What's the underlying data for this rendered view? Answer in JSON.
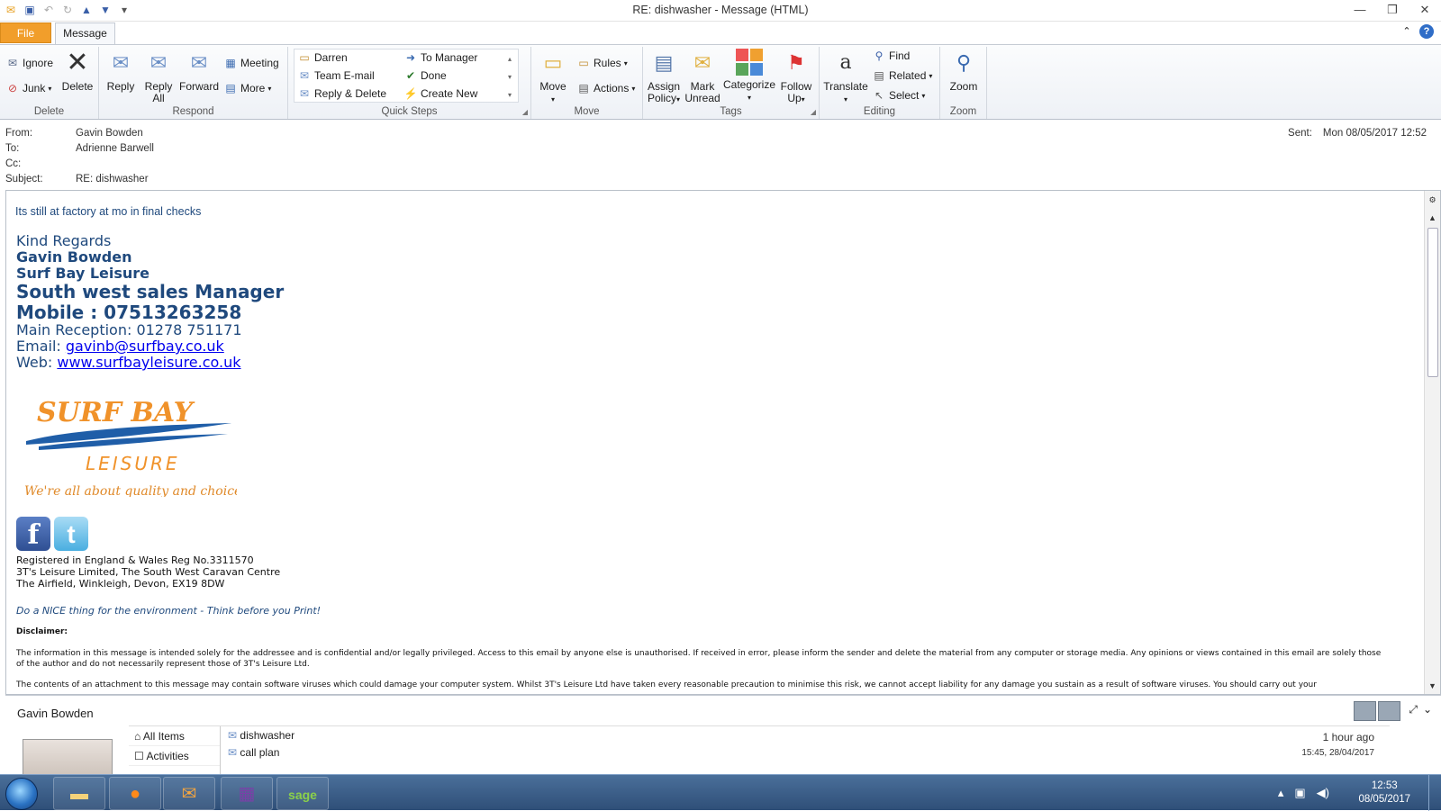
{
  "window": {
    "title": "RE: dishwasher  -  Message (HTML)",
    "min": "—",
    "max": "❐",
    "close": "✕"
  },
  "tabs": {
    "file": "File",
    "message": "Message"
  },
  "ribbon": {
    "delete_group": {
      "ignore": "Ignore",
      "junk": "Junk",
      "delete": "Delete",
      "label": "Delete"
    },
    "respond_group": {
      "reply": "Reply",
      "reply_all_1": "Reply",
      "reply_all_2": "All",
      "forward": "Forward",
      "meeting": "Meeting",
      "more": "More",
      "label": "Respond"
    },
    "quick_steps": {
      "items": [
        "Darren",
        "Team E-mail",
        "Reply & Delete",
        "To Manager",
        "Done",
        "Create New"
      ],
      "label": "Quick Steps"
    },
    "move_group": {
      "move": "Move",
      "rules": "Rules",
      "actions": "Actions",
      "label": "Move"
    },
    "tags_group": {
      "assign_1": "Assign",
      "assign_2": "Policy",
      "mark_1": "Mark",
      "mark_2": "Unread",
      "categorize": "Categorize",
      "follow_1": "Follow",
      "follow_2": "Up",
      "label": "Tags"
    },
    "editing_group": {
      "translate": "Translate",
      "find": "Find",
      "related": "Related",
      "select": "Select",
      "label": "Editing"
    },
    "zoom_group": {
      "zoom": "Zoom",
      "label": "Zoom"
    }
  },
  "header": {
    "from_label": "From:",
    "from": "Gavin Bowden",
    "to_label": "To:",
    "to": "Adrienne Barwell",
    "cc_label": "Cc:",
    "cc": "",
    "subject_label": "Subject:",
    "subject": "RE: dishwasher",
    "sent_label": "Sent:",
    "sent": "Mon 08/05/2017 12:52"
  },
  "body": {
    "opening": "Its still at factory at mo in final checks",
    "regards": "Kind Regards",
    "name": "Gavin Bowden",
    "company": "Surf Bay Leisure",
    "role": "South west sales Manager",
    "mobile": "Mobile : 07513263258",
    "reception": "Main Reception:  01278 751171",
    "email_label": "Email: ",
    "email": "gavinb@surfbay.co.uk",
    "web_label": "Web: ",
    "web": "www.surfbayleisure.co.uk",
    "logo": {
      "line1": "SURF BAY",
      "line2": "LEISURE",
      "tagline": "We're all about quality and choice!"
    },
    "reg_1": "Registered in England & Wales Reg No.3311570",
    "reg_2": "3T's Leisure Limited, The South West Caravan Centre",
    "reg_3": "The Airfield, Winkleigh, Devon, EX19 8DW",
    "nice": "Do a NICE thing for the environment - Think before you Print!",
    "disclaimer_title": "Disclaimer:",
    "disclaimer_1": "The information in this message is intended solely for the addressee and is confidential and/or legally privileged. Access to this email by anyone else is unauthorised. If received in error, please inform the sender and delete the material from any computer or storage media. Any opinions or views contained in this email are solely those of the author and do not necessarily represent those of 3T's Leisure Ltd.",
    "disclaimer_2": "The contents of an attachment to this message may contain software viruses which could damage your computer system. Whilst 3T's Leisure Ltd have taken every reasonable precaution to minimise this risk, we cannot accept liability for any damage you sustain as a result of software viruses. You should carry out your"
  },
  "people_pane": {
    "name": "Gavin Bowden",
    "nav": [
      "All Items",
      "Activities"
    ],
    "items": [
      {
        "subject": "dishwasher",
        "time": "1 hour ago"
      },
      {
        "subject": "call plan",
        "time": "15:45, 28/04/2017"
      }
    ]
  },
  "taskbar": {
    "time": "12:53",
    "date": "08/05/2017"
  }
}
